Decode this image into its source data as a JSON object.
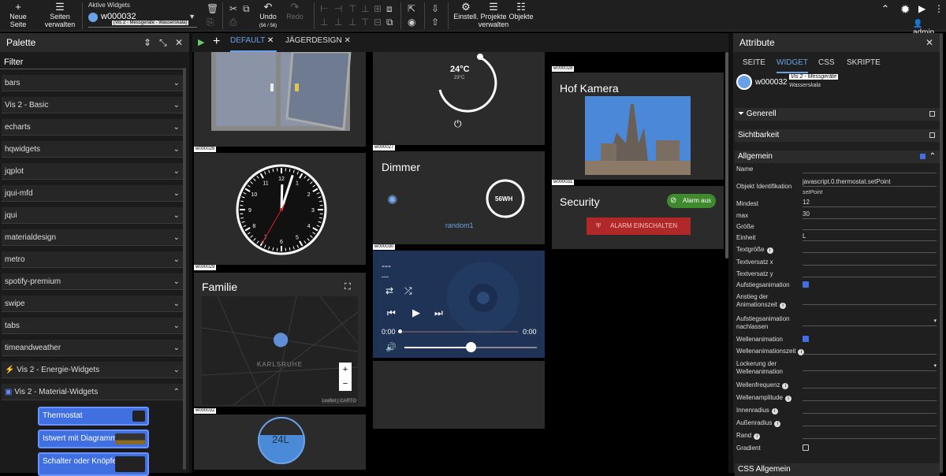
{
  "toolbar": {
    "new_page": "Neue Seite",
    "manage_pages": "Seiten verwalten",
    "active_widgets_label": "Aktive Widgets",
    "active_widget_id": "w000032",
    "active_widget_sub": "(Vis 2 - Messgeräte - Wasserskala)",
    "undo_label": "Undo",
    "undo_count": "(56 / 56)",
    "redo_label": "Redo",
    "settings": "Einstell.",
    "manage_projects": "Projekte verwalten",
    "objects": "Objekte",
    "user": "admin"
  },
  "palette": {
    "title": "Palette",
    "filter": "Filter",
    "items": [
      "bars",
      "Vis 2 - Basic",
      "echarts",
      "hqwidgets",
      "jqplot",
      "jqui-mfd",
      "jqui",
      "materialdesign",
      "metro",
      "spotify-premium",
      "swipe",
      "tabs",
      "timeandweather"
    ],
    "energy": "Vis 2 - Energie-Widgets",
    "material": "Vis 2 - Material-Widgets",
    "widgets": [
      "Thermostat",
      "Istwert mit Diagramm",
      "Schalter oder Knöpfe"
    ]
  },
  "tabs": {
    "default": "DEFAULT",
    "jaeger": "JÄGERDESIGN"
  },
  "canvas": {
    "ids": {
      "w26": "w000026",
      "w27": "w000027",
      "w28": "w000028",
      "w29": "w000029",
      "w30": "w000030",
      "w31": "w000031",
      "w32": "w000032"
    },
    "thermo_value": "24°C",
    "thermo_sub": "23°C",
    "dimmer_title": "Dimmer",
    "dimmer_value": "56WH",
    "dimmer_sub": "random1",
    "familie_title": "Familie",
    "map_city": "KARLSRUHE",
    "map_attr": "Leaflet | CARTO",
    "map_zoom_in": "+",
    "map_zoom_out": "−",
    "media_title": "---",
    "media_sub": "---",
    "media_time_start": "0:00",
    "media_time_end": "0:00",
    "hof_title": "Hof Kamera",
    "security_title": "Security",
    "alarm_status": "Alarm aus",
    "alarm_button": "ALARM EINSCHALTEN",
    "water_value": "24L",
    "clock": {
      "hour": 12,
      "minute": 3,
      "second": 35
    }
  },
  "attrs": {
    "title": "Attribute",
    "tabs": [
      "SEITE",
      "WIDGET",
      "CSS",
      "SKRIPTE"
    ],
    "widget_id": "w000032",
    "widget_name": "Vis 2 - Messgeräte",
    "widget_sub": "Wasserskala",
    "sect_generell": "Generell",
    "sect_sicht": "Sichtbarkeit",
    "sect_allgemein": "Allgemein",
    "sect_css": "CSS Allgemein",
    "fields": {
      "name": "Name",
      "oid": "Objekt Identifikation",
      "oid_val": "javascript.0.thermostat.setPoint",
      "oid_sub": "setPoint",
      "min": "Mindest",
      "min_val": "12",
      "max": "max",
      "max_val": "30",
      "size": "Größe",
      "unit": "Einheit",
      "unit_val": "L",
      "fontsize": "Textgröße",
      "offx": "Textversatz x",
      "offy": "Textversatz y",
      "riseanim": "Aufstiegsanimation",
      "risetime1": "Anstieg der",
      "risetime2": "Animationszeit",
      "risefade1": "Aufstiegsanimation",
      "risefade2": "nachlassen",
      "waveanim": "Wellenanimation",
      "wavetime": "Wellenanimationszeit",
      "wavelock1": "Lockerung der",
      "wavelock2": "Wellenanimation",
      "wavefreq": "Wellenfrequenz",
      "waveamp": "Wellenamplitude",
      "inner": "Innenradius",
      "outer": "Außenradius",
      "edge": "Rand",
      "gradient": "Gradient"
    }
  }
}
